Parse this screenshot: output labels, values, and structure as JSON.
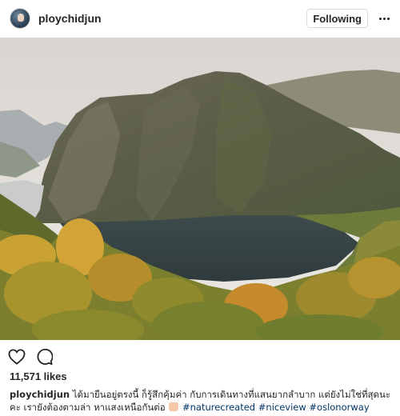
{
  "header": {
    "username": "ploychidjun",
    "follow_label": "Following"
  },
  "photo": {
    "alt_icon": "landscape-photo"
  },
  "actions": {
    "like_icon": "heart-icon",
    "comment_icon": "comment-icon"
  },
  "post": {
    "likes": "11,571 likes",
    "caption_user": "ploychidjun",
    "caption_text": "ได้มายืนอยู่ตรงนี้ ก็รู้สึกคุ้มค่า กับการเดินทางที่แสนยากลำบาก แต่ยังไม่ใช่ที่สุดนะคะ เรายังต้องตามล่า หาแสงเหนือกันต่อ",
    "hashtags": "#naturecreated #niceview #oslonorway"
  },
  "colors": {
    "link": "#003569",
    "text": "#262626",
    "border": "#dbdbdb"
  }
}
